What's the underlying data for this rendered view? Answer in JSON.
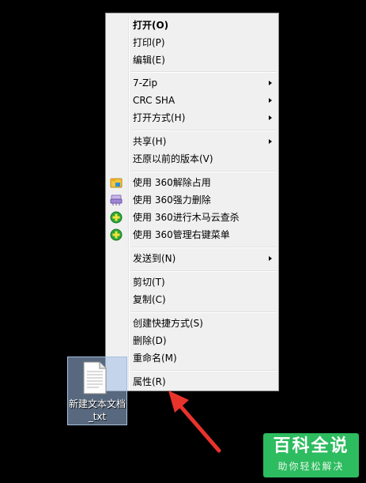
{
  "context_menu": {
    "items": [
      {
        "label": "打开(O)"
      },
      {
        "label": "打印(P)"
      },
      {
        "label": "编辑(E)"
      },
      {
        "label": "7-Zip"
      },
      {
        "label": "CRC SHA"
      },
      {
        "label": "打开方式(H)"
      },
      {
        "label": "共享(H)"
      },
      {
        "label": "还原以前的版本(V)"
      },
      {
        "label": "使用 360解除占用",
        "icon": "360-unlock-icon"
      },
      {
        "label": "使用 360强力删除",
        "icon": "360-shred-icon"
      },
      {
        "label": "使用 360进行木马云查杀",
        "icon": "360-scan-icon"
      },
      {
        "label": "使用 360管理右键菜单",
        "icon": "360-menu-manager-icon"
      },
      {
        "label": "发送到(N)"
      },
      {
        "label": "剪切(T)"
      },
      {
        "label": "复制(C)"
      },
      {
        "label": "创建快捷方式(S)"
      },
      {
        "label": "删除(D)"
      },
      {
        "label": "重命名(M)"
      },
      {
        "label": "属性(R)"
      }
    ]
  },
  "desktop_file": {
    "name_line1": "新建文本文档",
    "name_line2": "_txt",
    "icon": "text-file-icon"
  },
  "annotation": {
    "arrow_color": "#e8332c"
  },
  "watermark": {
    "title": "百科全说",
    "subtitle": "助你轻松解决",
    "color": "#2dbc5f"
  }
}
